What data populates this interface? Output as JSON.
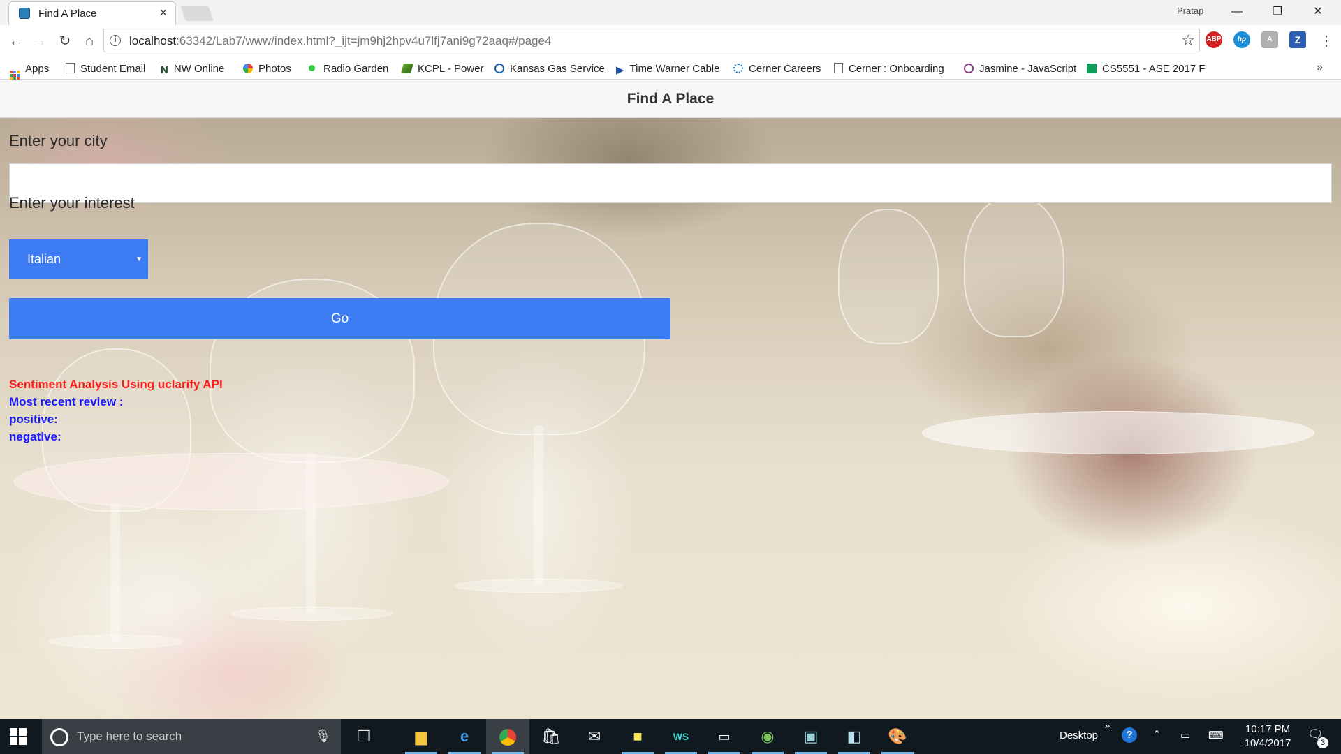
{
  "browser": {
    "tab_title": "Find A Place",
    "profile_name": "Pratap",
    "url_host": "localhost",
    "url_rest": ":63342/Lab7/www/index.html?_ijt=jm9hj2hpv4u7lfj7ani9g72aaq#/page4",
    "bookmarks": [
      {
        "label": "Apps",
        "icon": "apps-grid-icon"
      },
      {
        "label": "Student Email",
        "icon": "page-icon"
      },
      {
        "label": "NW Online",
        "icon": "n-logo-icon"
      },
      {
        "label": "Photos",
        "icon": "pinwheel-icon"
      },
      {
        "label": "Radio Garden",
        "icon": "green-dot-icon"
      },
      {
        "label": "KCPL - Power",
        "icon": "kcpl-logo-icon"
      },
      {
        "label": "Kansas Gas Service",
        "icon": "g-logo-icon"
      },
      {
        "label": "Time Warner Cable",
        "icon": "play-arrow-icon"
      },
      {
        "label": "Cerner Careers",
        "icon": "cerner-logo-icon"
      },
      {
        "label": "Cerner : Onboarding",
        "icon": "page-icon"
      },
      {
        "label": "Jasmine - JavaScript",
        "icon": "jasmine-logo-icon"
      },
      {
        "label": "CS5551 - ASE 2017 F",
        "icon": "sheets-icon"
      }
    ]
  },
  "page": {
    "header_title": "Find A Place",
    "city_label": "Enter your city",
    "city_value": "",
    "interest_label": "Enter your interest",
    "interest_selected": "Italian",
    "go_label": "Go",
    "sentiment_title": "Sentiment Analysis Using uclarify API",
    "recent_review_label": "Most recent review :",
    "positive_label": "positive:",
    "negative_label": "negative:",
    "colors": {
      "accent": "#3d7cf2",
      "sentiment_title": "#ff1a1a",
      "result_text": "#1a1aff"
    }
  },
  "taskbar": {
    "search_placeholder": "Type here to search",
    "desktop_label": "Desktop",
    "time": "10:17 PM",
    "date": "10/4/2017",
    "notification_count": "3"
  }
}
